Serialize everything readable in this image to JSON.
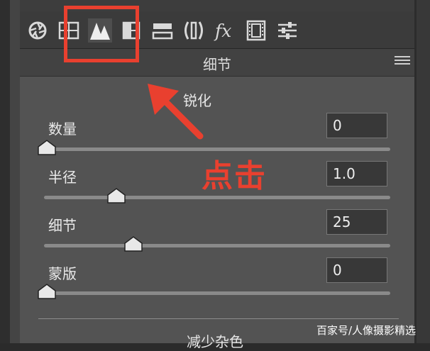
{
  "toolbar": {
    "icons": [
      {
        "name": "aperture-icon",
        "active": false
      },
      {
        "name": "histogram-grid-icon",
        "active": false
      },
      {
        "name": "detail-mountain-icon",
        "active": true
      },
      {
        "name": "split-panel-icon",
        "active": false
      },
      {
        "name": "split-toning-icon",
        "active": false
      },
      {
        "name": "lens-corrections-icon",
        "active": false
      },
      {
        "name": "fx-icon",
        "active": false
      },
      {
        "name": "film-icon",
        "active": false
      },
      {
        "name": "sliders-icon",
        "active": false
      }
    ]
  },
  "panel": {
    "title": "细节",
    "sharpen_title": "锐化",
    "params": [
      {
        "label": "数量",
        "value": "0",
        "slider_fraction": 0.0
      },
      {
        "label": "半径",
        "value": "1.0",
        "slider_fraction": 0.2
      },
      {
        "label": "细节",
        "value": "25",
        "slider_fraction": 0.25
      },
      {
        "label": "蒙版",
        "value": "0",
        "slider_fraction": 0.0
      }
    ],
    "next_section": "减少杂色"
  },
  "annotation": {
    "click_text": "点击",
    "color": "#e9402f"
  },
  "watermark": "百家号/人像摄影精选"
}
